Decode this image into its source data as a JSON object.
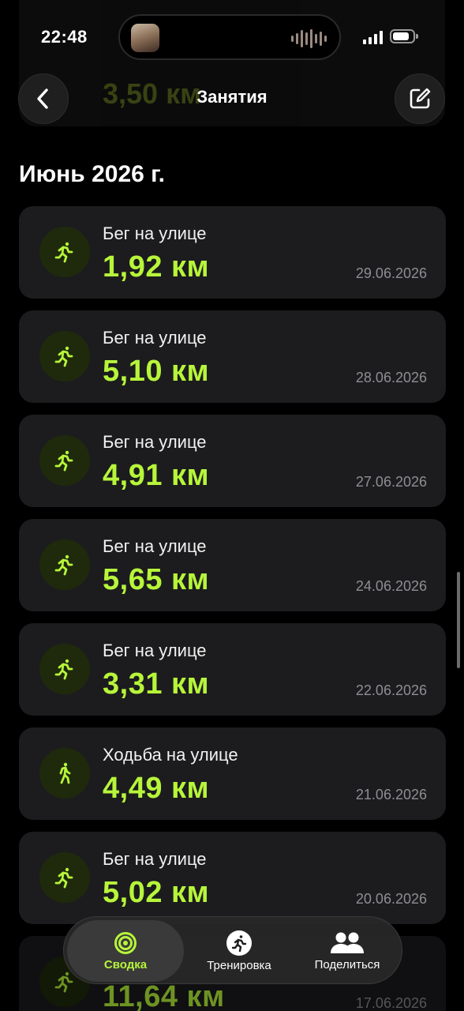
{
  "status_bar": {
    "time": "22:48",
    "battery_level": 0.85
  },
  "header": {
    "title": "Занятия",
    "back_icon": "chevron-left-icon",
    "edit_icon": "square-pencil-icon"
  },
  "section": {
    "title": "Июнь 2026 г."
  },
  "activities": [
    {
      "label": "Бег на улице",
      "value": "1,92 км",
      "date": "29.06.2026",
      "icon": "running-icon"
    },
    {
      "label": "Бег на улице",
      "value": "5,10 км",
      "date": "28.06.2026",
      "icon": "running-icon"
    },
    {
      "label": "Бег на улице",
      "value": "4,91 км",
      "date": "27.06.2026",
      "icon": "running-icon"
    },
    {
      "label": "Бег на улице",
      "value": "5,65 км",
      "date": "24.06.2026",
      "icon": "running-icon"
    },
    {
      "label": "Бег на улице",
      "value": "3,31 км",
      "date": "22.06.2026",
      "icon": "running-icon"
    },
    {
      "label": "Ходьба на улице",
      "value": "4,49 км",
      "date": "21.06.2026",
      "icon": "walking-icon"
    },
    {
      "label": "Бег на улице",
      "value": "5,02 км",
      "date": "20.06.2026",
      "icon": "running-icon"
    },
    {
      "label": "",
      "value": "11,64 км",
      "date": "17.06.2026",
      "icon": "running-icon"
    }
  ],
  "ghost_header": {
    "value": "3,50 км"
  },
  "tabbar": {
    "tabs": [
      {
        "label": "Сводка",
        "icon": "activity-rings-icon",
        "active": true
      },
      {
        "label": "Тренировка",
        "icon": "running-icon",
        "active": false
      },
      {
        "label": "Поделиться",
        "icon": "people-icon",
        "active": false
      }
    ]
  },
  "colors": {
    "accent": "#b7f53a",
    "card": "#1c1c1e",
    "background": "#000000",
    "secondary_text": "#8e8e93"
  }
}
